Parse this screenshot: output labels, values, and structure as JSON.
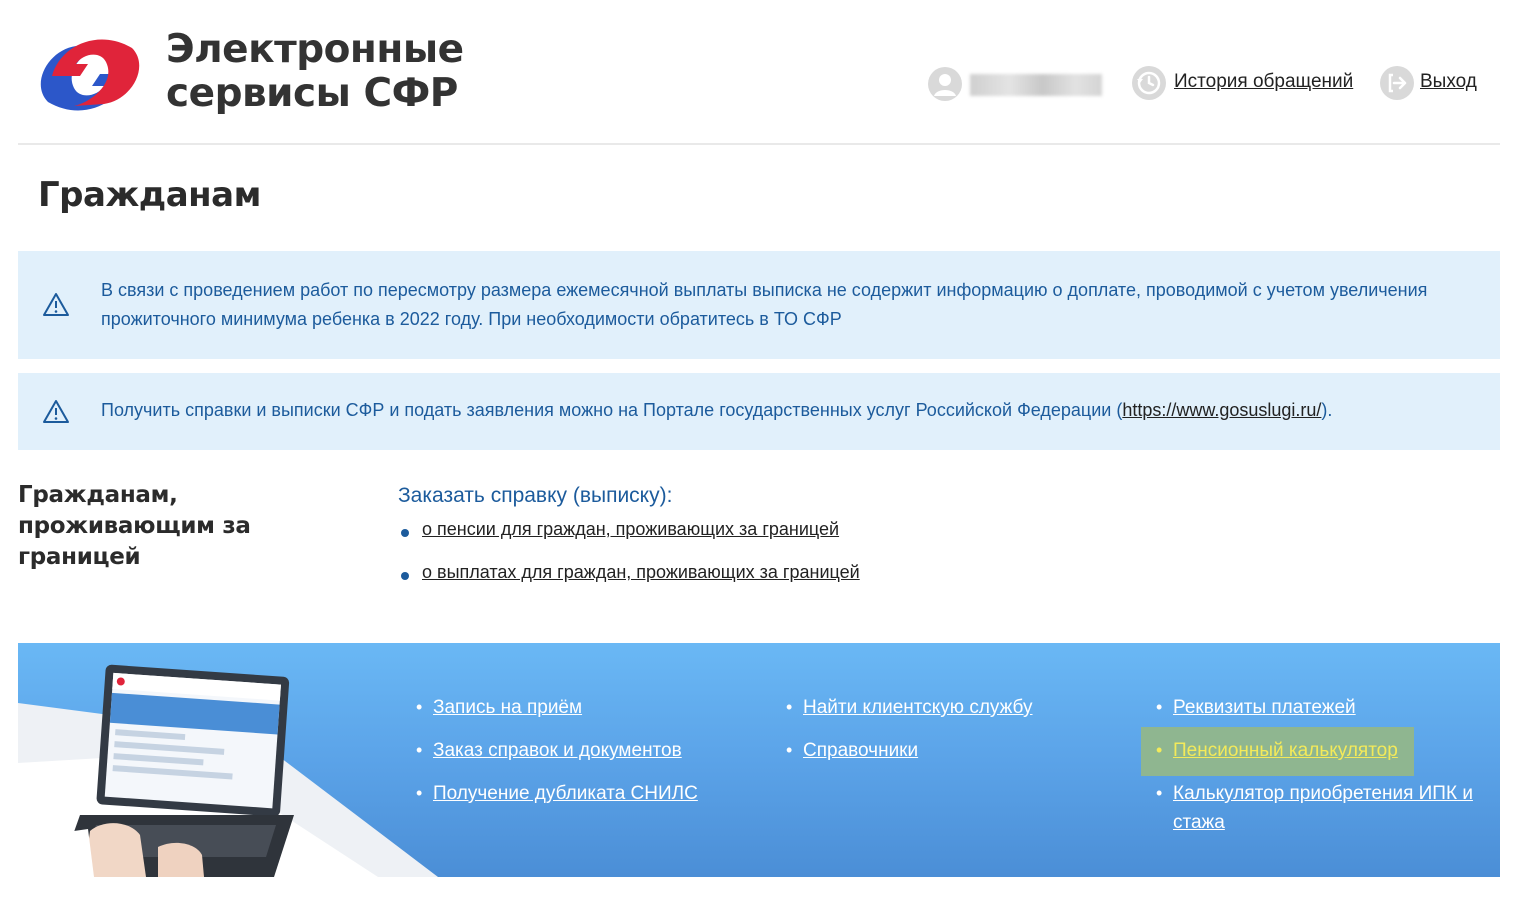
{
  "header": {
    "brand_line1": "Электронные",
    "brand_line2": "сервисы СФР",
    "history_label": "История обращений",
    "exit_label": "Выход"
  },
  "page_title": "Гражданам",
  "notices": [
    {
      "text": "В связи с проведением работ по пересмотру размера ежемесячной выплаты выписка не содержит информацию о доплате, проводимой с учетом увеличения прожиточного минимума ребенка в 2022 году. При необходимости обратитесь в ТО СФР"
    },
    {
      "text_before": "Получить справки и выписки СФР и подать заявления можно на Портале государственных услуг Российской Федерации (",
      "link": "https://www.gosuslugi.ru/",
      "text_after": ")."
    }
  ],
  "abroad": {
    "title": "Гражданам, проживающим за границей",
    "order_title": "Заказать справку (выписку):",
    "items": [
      "о пенсии для граждан, проживающих за границей",
      "о выплатах для граждан, проживающих за границей"
    ]
  },
  "banner": {
    "col1": [
      "Запись на приём",
      "Заказ справок и документов",
      "Получение дубликата СНИЛС"
    ],
    "col2": [
      "Найти клиентскую службу",
      "Справочники"
    ],
    "col3": [
      "Реквизиты платежей",
      "Пенсионный калькулятор",
      "Калькулятор приобретения ИПК и стажа"
    ]
  },
  "colors": {
    "accent_blue": "#1c5b9c",
    "notice_bg": "#e1f0fb",
    "banner_blue": "#5ba3e8",
    "highlight": "#8fb690",
    "highlight_text": "#f3ea5a"
  }
}
